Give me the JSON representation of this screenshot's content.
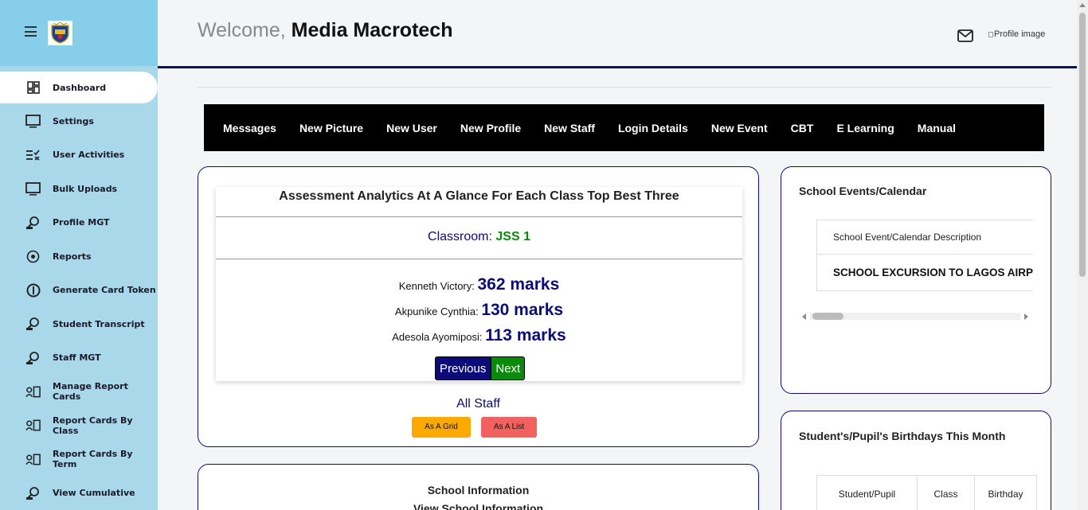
{
  "sidebar": {
    "items": [
      {
        "label": "Dashboard",
        "icon": "dashboard-icon",
        "active": true
      },
      {
        "label": "Settings",
        "icon": "monitor-icon"
      },
      {
        "label": "User Activities",
        "icon": "list-check-icon"
      },
      {
        "label": "Bulk Uploads",
        "icon": "monitor-icon"
      },
      {
        "label": "Profile MGT",
        "icon": "user-search-icon"
      },
      {
        "label": "Reports",
        "icon": "radio-circle-icon"
      },
      {
        "label": "Generate Card Token",
        "icon": "info-circle-icon"
      },
      {
        "label": "Student Transcript",
        "icon": "user-search-icon"
      },
      {
        "label": "Staff MGT",
        "icon": "user-search-icon"
      },
      {
        "label": "Manage Report Cards",
        "icon": "id-card-icon"
      },
      {
        "label": "Report Cards By Class",
        "icon": "id-card-icon"
      },
      {
        "label": "Report Cards By Term",
        "icon": "id-card-icon"
      },
      {
        "label": "View Cumulative",
        "icon": "user-search-icon"
      }
    ]
  },
  "header": {
    "greeting": "Welcome,",
    "name": "Media Macrotech",
    "profile_alt": "Profile image"
  },
  "quicknav": [
    "Messages",
    "New Picture",
    "New User",
    "New Profile",
    "New Staff",
    "Login Details",
    "New Event",
    "CBT",
    "E Learning",
    "Manual"
  ],
  "analytics": {
    "title": "Assessment Analytics At A Glance For Each Class Top Best Three",
    "classroom_label": "Classroom:",
    "classroom_value": "JSS 1",
    "ranks": [
      {
        "name": "Kenneth Victory:",
        "marks": "362 marks"
      },
      {
        "name": "Akpunike Cynthia:",
        "marks": "130 marks"
      },
      {
        "name": "Adesola Ayomiposi:",
        "marks": "113 marks"
      }
    ],
    "prev_label": "Previous",
    "next_label": "Next",
    "all_staff": "All Staff",
    "grid_label": "As A Grid",
    "list_label": "As A List"
  },
  "school_info": {
    "title": "School Information",
    "link": "View School Information"
  },
  "events": {
    "title": "School Events/Calendar",
    "col_header": "School Event/Calendar Description",
    "rows": [
      "SCHOOL EXCURSION TO LAGOS AIRPORT"
    ]
  },
  "birthdays": {
    "title": "Student's/Pupil's Birthdays This Month",
    "columns": [
      "Student/Pupil",
      "Class",
      "Birthday"
    ]
  },
  "colors": {
    "accent_navy": "#0b0b7a",
    "accent_green": "#0a8a0a",
    "sidebar_bg": "#a8d8ea",
    "sidebar_top": "#87ceeb",
    "grid_btn": "#ffa800",
    "list_btn": "#f26060"
  }
}
